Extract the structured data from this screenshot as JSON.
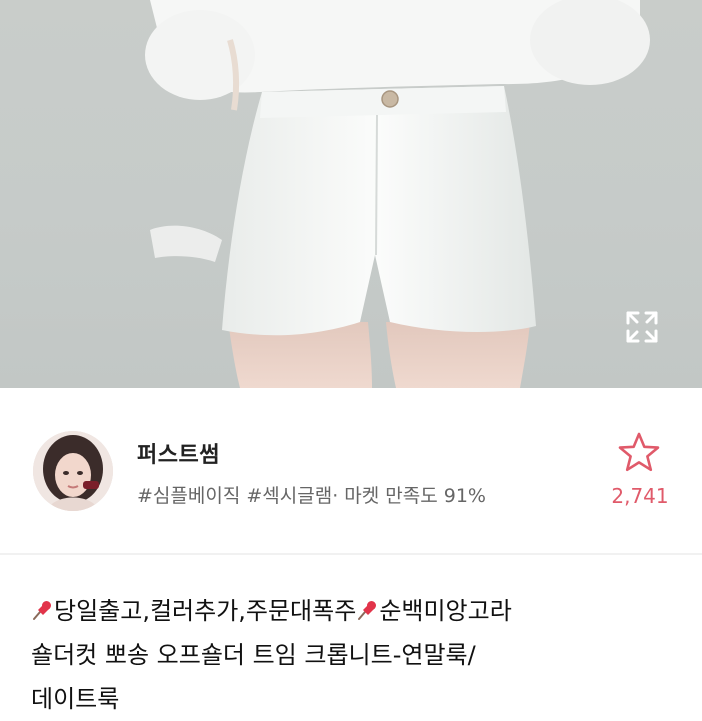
{
  "product_image": {
    "expand_icon": "expand-arrows-icon",
    "alt": "white high-waist shorts photo"
  },
  "seller": {
    "name": "퍼스트썸",
    "tags": "#심플베이직 #섹시글램· 마켓 만족도 91%",
    "favorite_icon": "star-outline-icon",
    "favorite_count": "2,741",
    "accent_color": "#e05a6a"
  },
  "product": {
    "title_line1_part1": "당일출고,컬러추가,주문대폭주",
    "title_line1_part2": "순백미앙고라",
    "title_line2": "숄더컷 뽀송 오프숄더 트임 크롭니트-연말룩/",
    "title_line3": "데이트룩",
    "pin_icon": "pushpin-icon"
  }
}
